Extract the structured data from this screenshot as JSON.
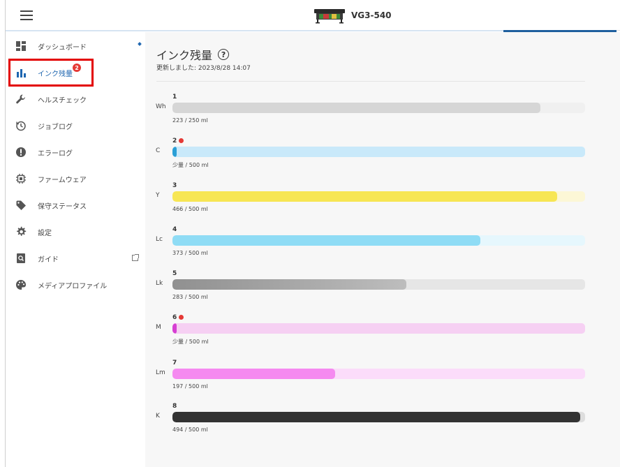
{
  "header": {
    "device_name": "VG3-540"
  },
  "sidebar": {
    "items": [
      {
        "name": "dashboard",
        "label": "ダッシュボード",
        "icon": "dashboard-icon"
      },
      {
        "name": "ink-level",
        "label": "インク残量",
        "icon": "bar-chart-icon",
        "badge": "2",
        "active": true
      },
      {
        "name": "health-check",
        "label": "ヘルスチェック",
        "icon": "wrench-icon"
      },
      {
        "name": "job-log",
        "label": "ジョブログ",
        "icon": "history-icon"
      },
      {
        "name": "error-log",
        "label": "エラーログ",
        "icon": "error-icon"
      },
      {
        "name": "firmware",
        "label": "ファームウェア",
        "icon": "chip-icon"
      },
      {
        "name": "maintenance-status",
        "label": "保守ステータス",
        "icon": "tag-icon"
      },
      {
        "name": "settings",
        "label": "設定",
        "icon": "gear-icon"
      },
      {
        "name": "guide",
        "label": "ガイド",
        "icon": "guide-icon"
      },
      {
        "name": "media-profile",
        "label": "メディアプロファイル",
        "icon": "palette-icon"
      }
    ]
  },
  "main": {
    "title": "インク残量",
    "updated": "更新しました: 2023/8/28 14:07",
    "inks": [
      {
        "num": "1",
        "code": "Wh",
        "amount": "223 / 250 ml",
        "level": 0.892,
        "warn": false,
        "fill": "#d6d6d6",
        "track": "#f0f0f0"
      },
      {
        "num": "2",
        "code": "C",
        "amount": "少量 / 500 ml",
        "level": 0.01,
        "warn": true,
        "fill": "#2b9fd6",
        "track": "#c9e9fa"
      },
      {
        "num": "3",
        "code": "Y",
        "amount": "466 / 500 ml",
        "level": 0.932,
        "warn": false,
        "fill": "#f7e654",
        "track": "#fcf7d6"
      },
      {
        "num": "4",
        "code": "Lc",
        "amount": "373 / 500 ml",
        "level": 0.746,
        "warn": false,
        "fill": "#8fdcf5",
        "track": "#e6f7fd"
      },
      {
        "num": "5",
        "code": "Lk",
        "amount": "283 / 500 ml",
        "level": 0.566,
        "warn": false,
        "fill": "linear-gradient(90deg,#909090,#bdbdbd)",
        "track": "#e6e6e6"
      },
      {
        "num": "6",
        "code": "M",
        "amount": "少量 / 500 ml",
        "level": 0.01,
        "warn": true,
        "fill": "#d63fd2",
        "track": "#f6d0f3"
      },
      {
        "num": "7",
        "code": "Lm",
        "amount": "197 / 500 ml",
        "level": 0.394,
        "warn": false,
        "fill": "#f58af0",
        "track": "#fbdcfa"
      },
      {
        "num": "8",
        "code": "K",
        "amount": "494 / 500 ml",
        "level": 0.988,
        "warn": false,
        "fill": "#333333",
        "track": "#dddddd"
      }
    ]
  }
}
